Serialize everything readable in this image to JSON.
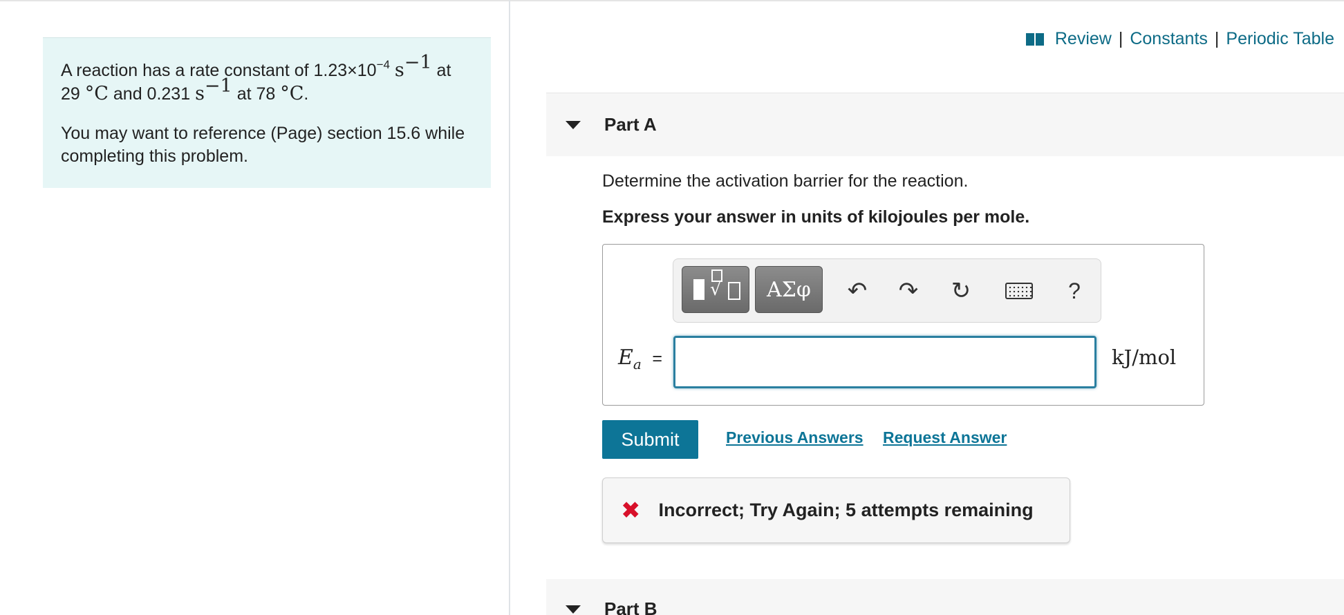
{
  "problem": {
    "line1_prefix": "A reaction has a rate constant of 1.23×10",
    "line1_exp": "−4",
    "line1_unit": "s",
    "line1_unit_exp": "−1",
    "line1_suffix": "at",
    "line2_temp1": "29",
    "line2_deg_c": "°C",
    "line2_and": "and 0.231",
    "line2_unit": "s",
    "line2_unit_exp": "−1",
    "line2_at": "at 78",
    "line2_deg_c2": "°C",
    "line2_period": ".",
    "reference_text": "You may want to reference (Page) section 15.6 while completing this problem."
  },
  "toplinks": {
    "review": "Review",
    "sep1": "|",
    "constants": "Constants",
    "sep2": "|",
    "periodic_table": "Periodic Table"
  },
  "part_a": {
    "title": "Part A",
    "question": "Determine the activation barrier for the reaction.",
    "instruction": "Express your answer in units of kilojoules per mole.",
    "toolbar": {
      "symbols_label": "ΑΣφ",
      "undo_glyph": "↶",
      "redo_glyph": "↷",
      "reset_glyph": "↻",
      "help_label": "?"
    },
    "variable": "E",
    "variable_sub": "a",
    "equals": "=",
    "input_value": "",
    "unit": "kJ/mol",
    "submit_label": "Submit",
    "previous_answers": "Previous Answers",
    "request_answer": "Request Answer",
    "feedback": "Incorrect; Try Again; 5 attempts remaining"
  },
  "part_b": {
    "title": "Part B"
  },
  "colors": {
    "accent": "#0d7597",
    "link": "#0d6b86",
    "error": "#d8102a",
    "problem_bg": "#e6f6f6"
  }
}
